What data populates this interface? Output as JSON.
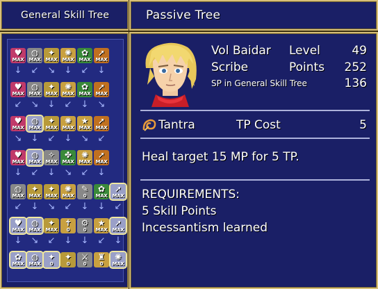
{
  "tabs": {
    "general": "General Skill Tree",
    "passive": "Passive Tree"
  },
  "actor": {
    "name": "Vol Baidar",
    "class": "Scribe",
    "level_label": "Level",
    "level": "49",
    "points_label": "Points",
    "points": "252",
    "sp_label": "SP in General Skill Tree",
    "sp": "136"
  },
  "skill": {
    "name": "Tantra",
    "cost_label": "TP Cost",
    "cost": "5",
    "description": "Heal target 15 MP for 5 TP.",
    "requirements_header": "REQUIREMENTS:",
    "requirements": [
      "5 Skill Points",
      "Incessantism learned"
    ]
  },
  "grid": {
    "rows": [
      [
        {
          "t": "MAX",
          "c": "#c03a6a",
          "g": "♥"
        },
        {
          "t": "MAX",
          "c": "#888",
          "g": "◍"
        },
        {
          "t": "MAX",
          "c": "#b89a3a",
          "g": "✦"
        },
        {
          "t": "MAX",
          "c": "#c8a040",
          "g": "✺"
        },
        {
          "t": "MAX",
          "c": "#3a8a3a",
          "g": "✿"
        },
        {
          "t": "MAX",
          "c": "#c07020",
          "g": "➚"
        }
      ],
      [
        {
          "t": "MAX",
          "c": "#c03a6a",
          "g": "♥"
        },
        {
          "t": "MAX",
          "c": "#888",
          "g": "◍"
        },
        {
          "t": "MAX",
          "c": "#b89a3a",
          "g": "✦"
        },
        {
          "t": "MAX",
          "c": "#c8a040",
          "g": "✺"
        },
        {
          "t": "MAX",
          "c": "#3a8a3a",
          "g": "✿"
        },
        {
          "t": "MAX",
          "c": "#c07020",
          "g": "➚"
        }
      ],
      [
        {
          "t": "MAX",
          "c": "#c03a6a",
          "g": "♥"
        },
        {
          "t": "MAX",
          "c": "#6a6aa0",
          "g": "◍",
          "s": true
        },
        {
          "t": "MAX",
          "c": "#b89a3a",
          "g": "✦"
        },
        {
          "t": "MAX",
          "c": "#c8a040",
          "g": "✺"
        },
        {
          "t": "MAX",
          "c": "#c8a040",
          "g": "★"
        },
        {
          "t": "MAX",
          "c": "#c07020",
          "g": "➚"
        }
      ],
      [
        {
          "t": "MAX",
          "c": "#c03a6a",
          "g": "♥"
        },
        {
          "t": "MAX",
          "c": "#6a6aa0",
          "g": "◍",
          "s": true
        },
        {
          "t": "MAX",
          "c": "#888",
          "g": "✧"
        },
        {
          "t": "MAX",
          "c": "#3a8a3a",
          "g": "✤"
        },
        {
          "t": "MAX",
          "c": "#c8a040",
          "g": "✺"
        },
        {
          "t": "MAX",
          "c": "#c07020",
          "g": "➚"
        }
      ],
      [
        {
          "t": "MAX",
          "c": "#888",
          "g": "◍"
        },
        {
          "t": "MAX",
          "c": "#b89a3a",
          "g": "✦"
        },
        {
          "t": "MAX",
          "c": "#b89a3a",
          "g": "✦"
        },
        {
          "t": "MAX",
          "c": "#c8a040",
          "g": "✺"
        },
        {
          "t": "0",
          "c": "#888",
          "g": "✎"
        },
        {
          "t": "MAX",
          "c": "#3a8a3a",
          "g": "✿"
        },
        {
          "t": "MAX",
          "c": "#c07020",
          "g": "➚",
          "s": true
        }
      ],
      [
        {
          "t": "MAX",
          "c": "#c03a6a",
          "g": "♥",
          "s": true
        },
        {
          "t": "MAX",
          "c": "#6a6aa0",
          "g": "◍",
          "s": true
        },
        {
          "t": "MAX",
          "c": "#b89a3a",
          "g": "✦"
        },
        {
          "t": "0",
          "c": "#c8a040",
          "g": "✝"
        },
        {
          "t": "0",
          "c": "#888",
          "g": "⚙"
        },
        {
          "t": "MAX",
          "c": "#c8a040",
          "g": "★"
        },
        {
          "t": "MAX",
          "c": "#c07020",
          "g": "➚",
          "s": true
        }
      ],
      [
        {
          "t": "MAX",
          "c": "#3a8a3a",
          "g": "✿",
          "s": true
        },
        {
          "t": "MAX",
          "c": "#6a6aa0",
          "g": "◍",
          "s": true
        },
        {
          "t": "0",
          "c": "#8a5a2a",
          "g": "✦",
          "s": true
        },
        {
          "t": "0",
          "c": "#b89a3a",
          "g": "✦"
        },
        {
          "t": "0",
          "c": "#888",
          "g": "⚔"
        },
        {
          "t": "0",
          "c": "#c8a040",
          "g": "♜"
        },
        {
          "t": "MAX",
          "c": "#c8a040",
          "g": "✺",
          "s": true
        }
      ]
    ]
  }
}
